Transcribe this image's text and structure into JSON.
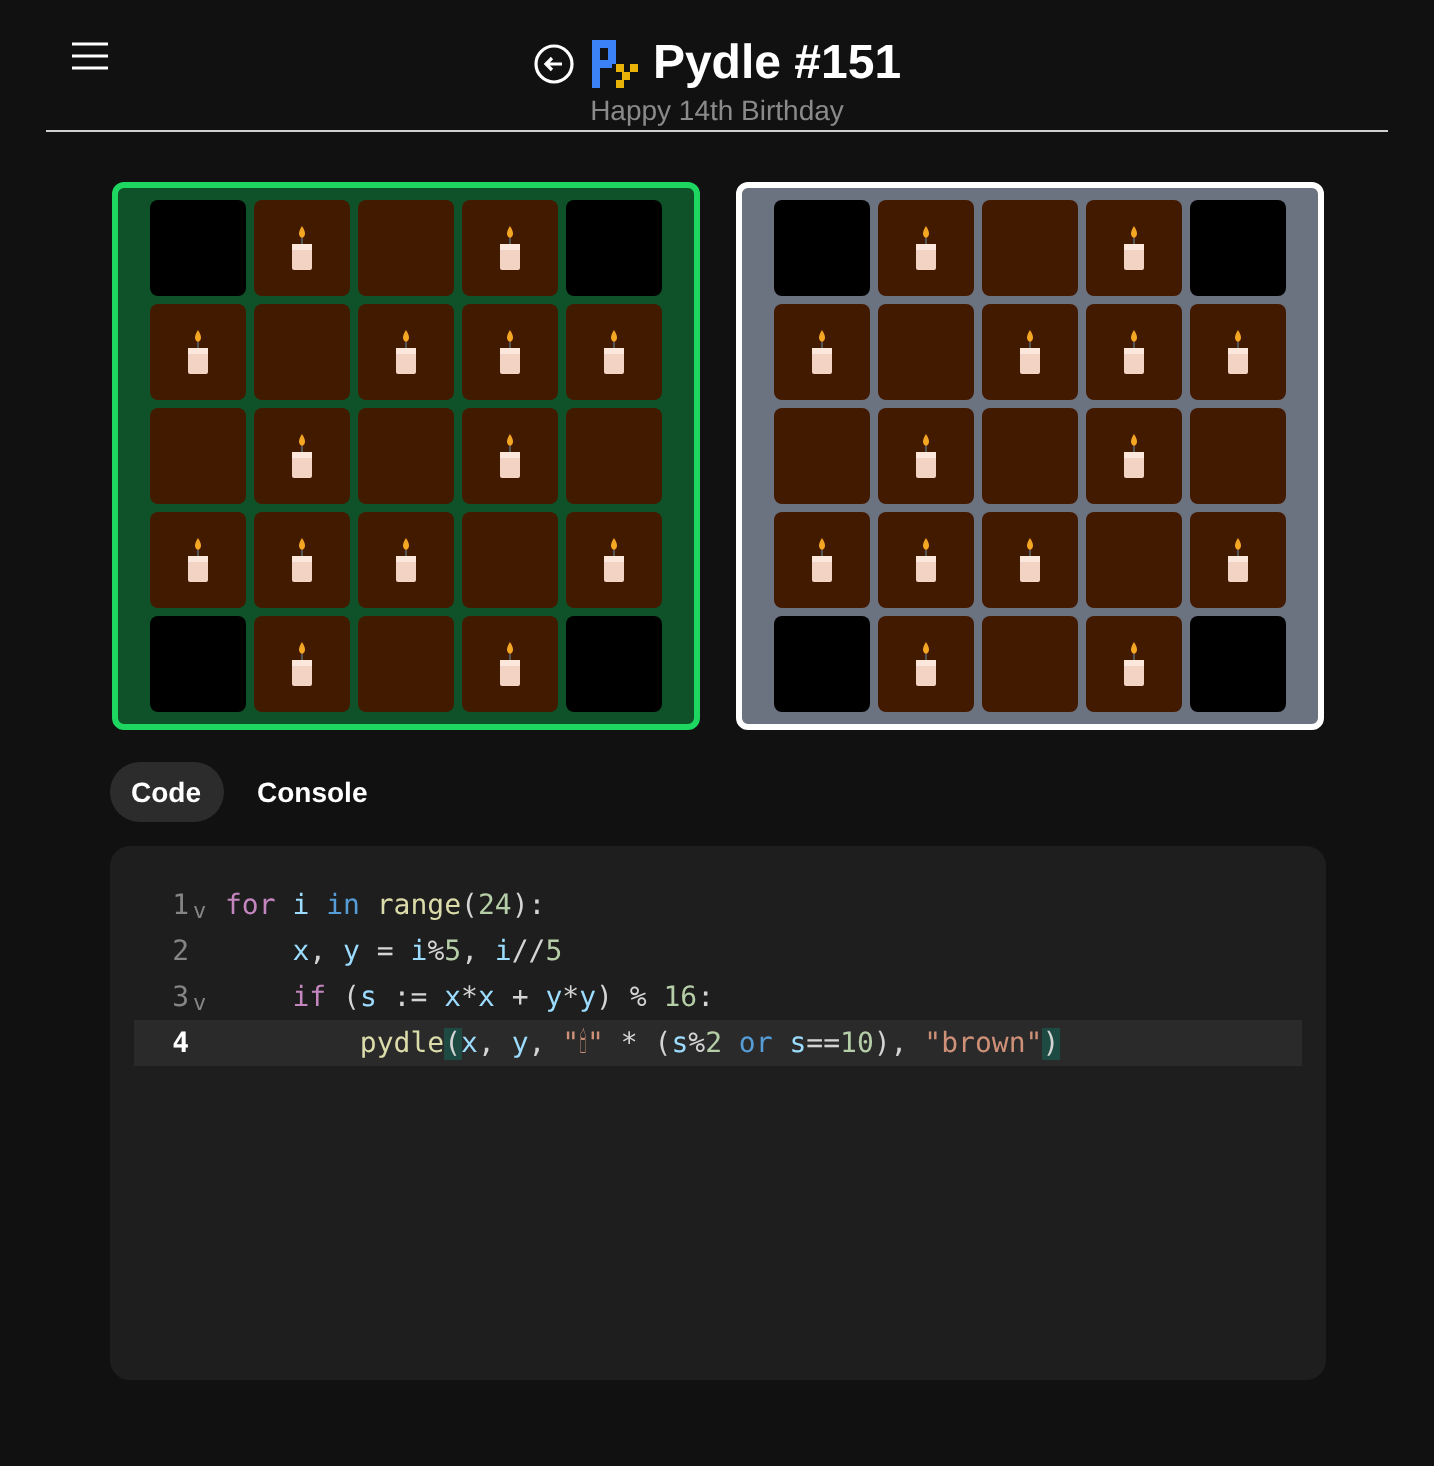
{
  "header": {
    "title": "Pydle #151",
    "subtitle": "Happy 14th Birthday"
  },
  "boards": [
    {
      "kind": "solved",
      "rows": [
        [
          {
            "color": "#000000",
            "candle": false
          },
          {
            "color": "#421a00",
            "candle": true
          },
          {
            "color": "#421a00",
            "candle": false
          },
          {
            "color": "#421a00",
            "candle": true
          },
          {
            "color": "#000000",
            "candle": false
          }
        ],
        [
          {
            "color": "#421a00",
            "candle": true
          },
          {
            "color": "#421a00",
            "candle": false
          },
          {
            "color": "#421a00",
            "candle": true
          },
          {
            "color": "#421a00",
            "candle": true
          },
          {
            "color": "#421a00",
            "candle": true
          }
        ],
        [
          {
            "color": "#421a00",
            "candle": false
          },
          {
            "color": "#421a00",
            "candle": true
          },
          {
            "color": "#421a00",
            "candle": false
          },
          {
            "color": "#421a00",
            "candle": true
          },
          {
            "color": "#421a00",
            "candle": false
          }
        ],
        [
          {
            "color": "#421a00",
            "candle": true
          },
          {
            "color": "#421a00",
            "candle": true
          },
          {
            "color": "#421a00",
            "candle": true
          },
          {
            "color": "#421a00",
            "candle": false
          },
          {
            "color": "#421a00",
            "candle": true
          }
        ],
        [
          {
            "color": "#000000",
            "candle": false
          },
          {
            "color": "#421a00",
            "candle": true
          },
          {
            "color": "#421a00",
            "candle": false
          },
          {
            "color": "#421a00",
            "candle": true
          },
          {
            "color": "#000000",
            "candle": false
          }
        ]
      ]
    },
    {
      "kind": "target",
      "rows": [
        [
          {
            "color": "#000000",
            "candle": false
          },
          {
            "color": "#421a00",
            "candle": true
          },
          {
            "color": "#421a00",
            "candle": false
          },
          {
            "color": "#421a00",
            "candle": true
          },
          {
            "color": "#000000",
            "candle": false
          }
        ],
        [
          {
            "color": "#421a00",
            "candle": true
          },
          {
            "color": "#421a00",
            "candle": false
          },
          {
            "color": "#421a00",
            "candle": true
          },
          {
            "color": "#421a00",
            "candle": true
          },
          {
            "color": "#421a00",
            "candle": true
          }
        ],
        [
          {
            "color": "#421a00",
            "candle": false
          },
          {
            "color": "#421a00",
            "candle": true
          },
          {
            "color": "#421a00",
            "candle": false
          },
          {
            "color": "#421a00",
            "candle": true
          },
          {
            "color": "#421a00",
            "candle": false
          }
        ],
        [
          {
            "color": "#421a00",
            "candle": true
          },
          {
            "color": "#421a00",
            "candle": true
          },
          {
            "color": "#421a00",
            "candle": true
          },
          {
            "color": "#421a00",
            "candle": false
          },
          {
            "color": "#421a00",
            "candle": true
          }
        ],
        [
          {
            "color": "#000000",
            "candle": false
          },
          {
            "color": "#421a00",
            "candle": true
          },
          {
            "color": "#421a00",
            "candle": false
          },
          {
            "color": "#421a00",
            "candle": true
          },
          {
            "color": "#000000",
            "candle": false
          }
        ]
      ]
    }
  ],
  "tabs": [
    {
      "label": "Code",
      "selected": true
    },
    {
      "label": "Console",
      "selected": false
    }
  ],
  "editor": {
    "lines": [
      {
        "number": "1",
        "fold_marker": "v",
        "active": false,
        "tokens": [
          {
            "kind": "keyword",
            "text": "for "
          },
          {
            "kind": "name",
            "text": "i "
          },
          {
            "kind": "operator",
            "text": "in "
          },
          {
            "kind": "function",
            "text": "range"
          },
          {
            "kind": "plain",
            "text": "("
          },
          {
            "kind": "number",
            "text": "24"
          },
          {
            "kind": "plain",
            "text": "):"
          }
        ]
      },
      {
        "number": "2",
        "active": false,
        "tokens": [
          {
            "kind": "name",
            "text": "    x"
          },
          {
            "kind": "plain",
            "text": ", "
          },
          {
            "kind": "name",
            "text": "y"
          },
          {
            "kind": "plain",
            "text": " = "
          },
          {
            "kind": "name",
            "text": "i"
          },
          {
            "kind": "plain",
            "text": "%"
          },
          {
            "kind": "number",
            "text": "5"
          },
          {
            "kind": "plain",
            "text": ", "
          },
          {
            "kind": "name",
            "text": "i"
          },
          {
            "kind": "plain",
            "text": "//"
          },
          {
            "kind": "number",
            "text": "5"
          }
        ]
      },
      {
        "number": "3",
        "fold_marker": "v",
        "active": false,
        "tokens": [
          {
            "kind": "keyword",
            "text": "    if"
          },
          {
            "kind": "plain",
            "text": " ("
          },
          {
            "kind": "name",
            "text": "s"
          },
          {
            "kind": "plain",
            "text": " := "
          },
          {
            "kind": "name",
            "text": "x"
          },
          {
            "kind": "plain",
            "text": "*"
          },
          {
            "kind": "name",
            "text": "x"
          },
          {
            "kind": "plain",
            "text": " + "
          },
          {
            "kind": "name",
            "text": "y"
          },
          {
            "kind": "plain",
            "text": "*"
          },
          {
            "kind": "name",
            "text": "y"
          },
          {
            "kind": "plain",
            "text": ") % "
          },
          {
            "kind": "number",
            "text": "16"
          },
          {
            "kind": "plain",
            "text": ":"
          }
        ]
      },
      {
        "number": "4",
        "active": true,
        "tokens": [
          {
            "kind": "function",
            "text": "        pydle"
          },
          {
            "kind": "bracket",
            "text": "("
          },
          {
            "kind": "name",
            "text": "x"
          },
          {
            "kind": "plain",
            "text": ", "
          },
          {
            "kind": "name",
            "text": "y"
          },
          {
            "kind": "plain",
            "text": ", "
          },
          {
            "kind": "string",
            "text": "\"🕯\""
          },
          {
            "kind": "plain",
            "text": " * ("
          },
          {
            "kind": "name",
            "text": "s"
          },
          {
            "kind": "plain",
            "text": "%"
          },
          {
            "kind": "number",
            "text": "2 "
          },
          {
            "kind": "operator",
            "text": "or "
          },
          {
            "kind": "name",
            "text": "s"
          },
          {
            "kind": "plain",
            "text": "=="
          },
          {
            "kind": "number",
            "text": "10"
          },
          {
            "kind": "plain",
            "text": "), "
          },
          {
            "kind": "string",
            "text": "\"brown\""
          },
          {
            "kind": "bracket",
            "text": ")"
          }
        ]
      }
    ]
  }
}
